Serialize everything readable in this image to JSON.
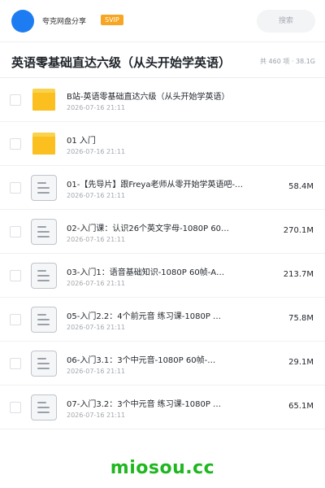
{
  "header": {
    "app_name": "夸克网盘分享",
    "badge": "SVIP",
    "search_placeholder": "搜索"
  },
  "folder": {
    "title": "英语零基础直达六级（从头开始学英语）",
    "summary": "共 460 项 · 38.1G"
  },
  "items": [
    {
      "type": "folder",
      "name": "B站-英语零基础直达六级（从头开始学英语）",
      "date": "2026-07-16 21:11",
      "size": ""
    },
    {
      "type": "folder",
      "name": "01 入门",
      "date": "2026-07-16 21:11",
      "size": ""
    },
    {
      "type": "file",
      "name": "01-【先导片】跟Freya老师从零开始学英语吧-…",
      "date": "2026-07-16 21:11",
      "size": "58.4M"
    },
    {
      "type": "file",
      "name": "02-入门课：认识26个英文字母-1080P 60…",
      "date": "2026-07-16 21:11",
      "size": "270.1M"
    },
    {
      "type": "file",
      "name": "03-入门1：语音基础知识-1080P 60帧-A…",
      "date": "2026-07-16 21:11",
      "size": "213.7M"
    },
    {
      "type": "file",
      "name": "05-入门2.2：4个前元音 练习课-1080P …",
      "date": "2026-07-16 21:11",
      "size": "75.8M"
    },
    {
      "type": "file",
      "name": "06-入门3.1：3个中元音-1080P 60帧-…",
      "date": "2026-07-16 21:11",
      "size": "29.1M"
    },
    {
      "type": "file",
      "name": "07-入门3.2：3个中元音 练习课-1080P …",
      "date": "2026-07-16 21:11",
      "size": "65.1M"
    }
  ],
  "watermark": "miosou.cc",
  "colors": {
    "accent": "#1e7cf2",
    "badge": "#f6a623",
    "folder": "#fbbf1f",
    "watermark": "#1fb71f"
  }
}
